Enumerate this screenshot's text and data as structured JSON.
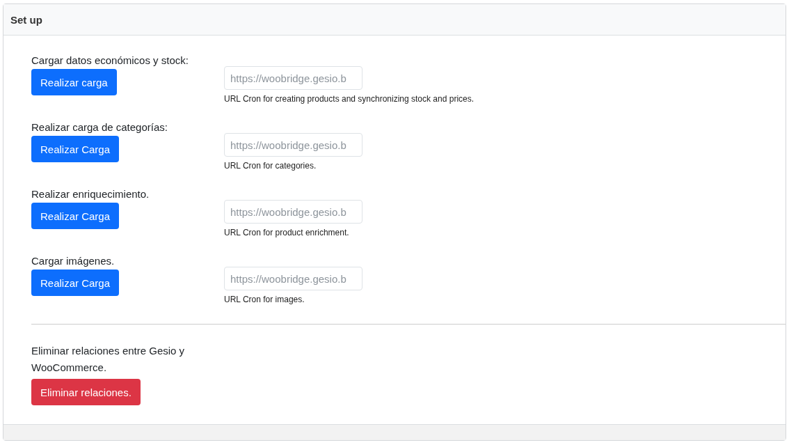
{
  "card": {
    "title": "Set up"
  },
  "tasks": [
    {
      "label": "Cargar datos económicos y stock:",
      "button": "Realizar carga",
      "placeholder": "https://woobridge.gesio.b",
      "help": "URL Cron for creating products and synchronizing stock and prices."
    },
    {
      "label": "Realizar carga de categorías:",
      "button": "Realizar Carga",
      "placeholder": "https://woobridge.gesio.b",
      "help": "URL Cron for categories."
    },
    {
      "label": "Realizar enriquecimiento.",
      "button": "Realizar Carga",
      "placeholder": "https://woobridge.gesio.b",
      "help": "URL Cron for product enrichment."
    },
    {
      "label": "Cargar imágenes.",
      "button": "Realizar Carga",
      "placeholder": "https://woobridge.gesio.b",
      "help": "URL Cron for images."
    }
  ],
  "danger": {
    "label": "Eliminar relaciones entre Gesio y WooCommerce.",
    "button": "Eliminar relaciones."
  }
}
